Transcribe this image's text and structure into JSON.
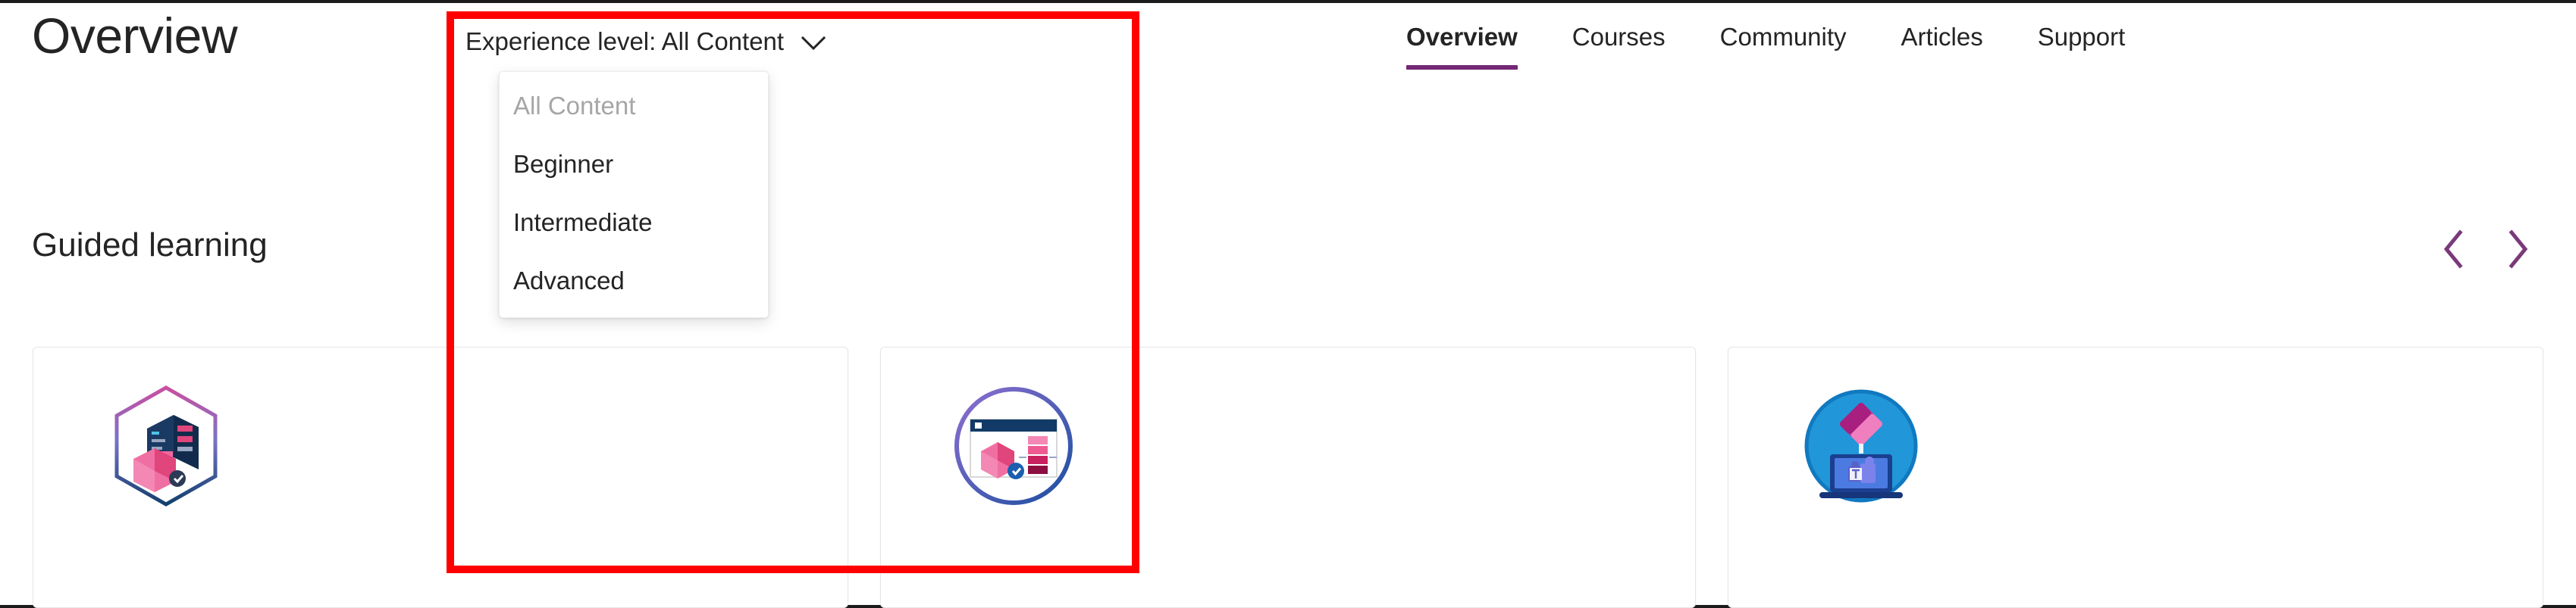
{
  "page": {
    "title": "Overview",
    "section_heading": "Guided learning"
  },
  "nav": {
    "items": [
      {
        "label": "Overview",
        "active": true
      },
      {
        "label": "Courses",
        "active": false
      },
      {
        "label": "Community",
        "active": false
      },
      {
        "label": "Articles",
        "active": false
      },
      {
        "label": "Support",
        "active": false
      }
    ],
    "active_indicator_color": "#742774"
  },
  "experience_filter": {
    "button_label": "Experience level: All Content",
    "selected_value": "All Content",
    "chevron_icon": "chevron-down-icon",
    "expanded": true,
    "options": [
      {
        "label": "All Content",
        "selected": true
      },
      {
        "label": "Beginner",
        "selected": false
      },
      {
        "label": "Intermediate",
        "selected": false
      },
      {
        "label": "Advanced",
        "selected": false
      }
    ]
  },
  "carousel": {
    "prev_icon": "chevron-left-icon",
    "next_icon": "chevron-right-icon",
    "arrow_color": "#7a3a7a"
  },
  "cards": [
    {
      "icon": "hexagon-dashboard-badge-icon"
    },
    {
      "icon": "circle-dataset-browser-badge-icon"
    },
    {
      "icon": "circle-teams-laptop-badge-icon"
    }
  ],
  "annotation": {
    "highlight_color": "#fe0000"
  }
}
